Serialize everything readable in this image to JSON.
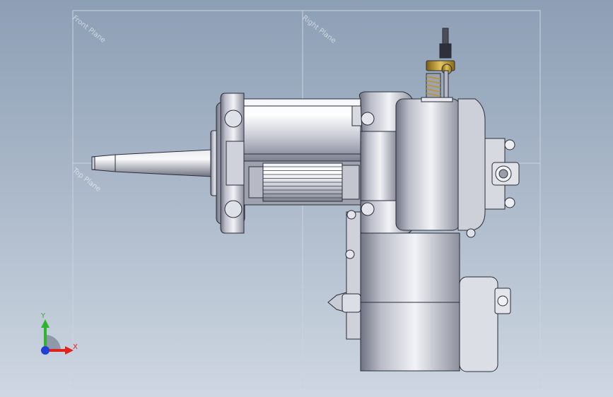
{
  "planes": {
    "front": "Front Plane",
    "right": "Right Plane",
    "top": "Top Plane"
  },
  "triad": {
    "x_label": "X",
    "y_label": "Y",
    "x_color": "#e0231c",
    "y_color": "#2fb52f",
    "z_color": "#1f3fd6"
  },
  "model": {
    "body_color": "#e6e8ef",
    "edge_color": "#2a2d38",
    "brass_color": "#b8962c"
  }
}
